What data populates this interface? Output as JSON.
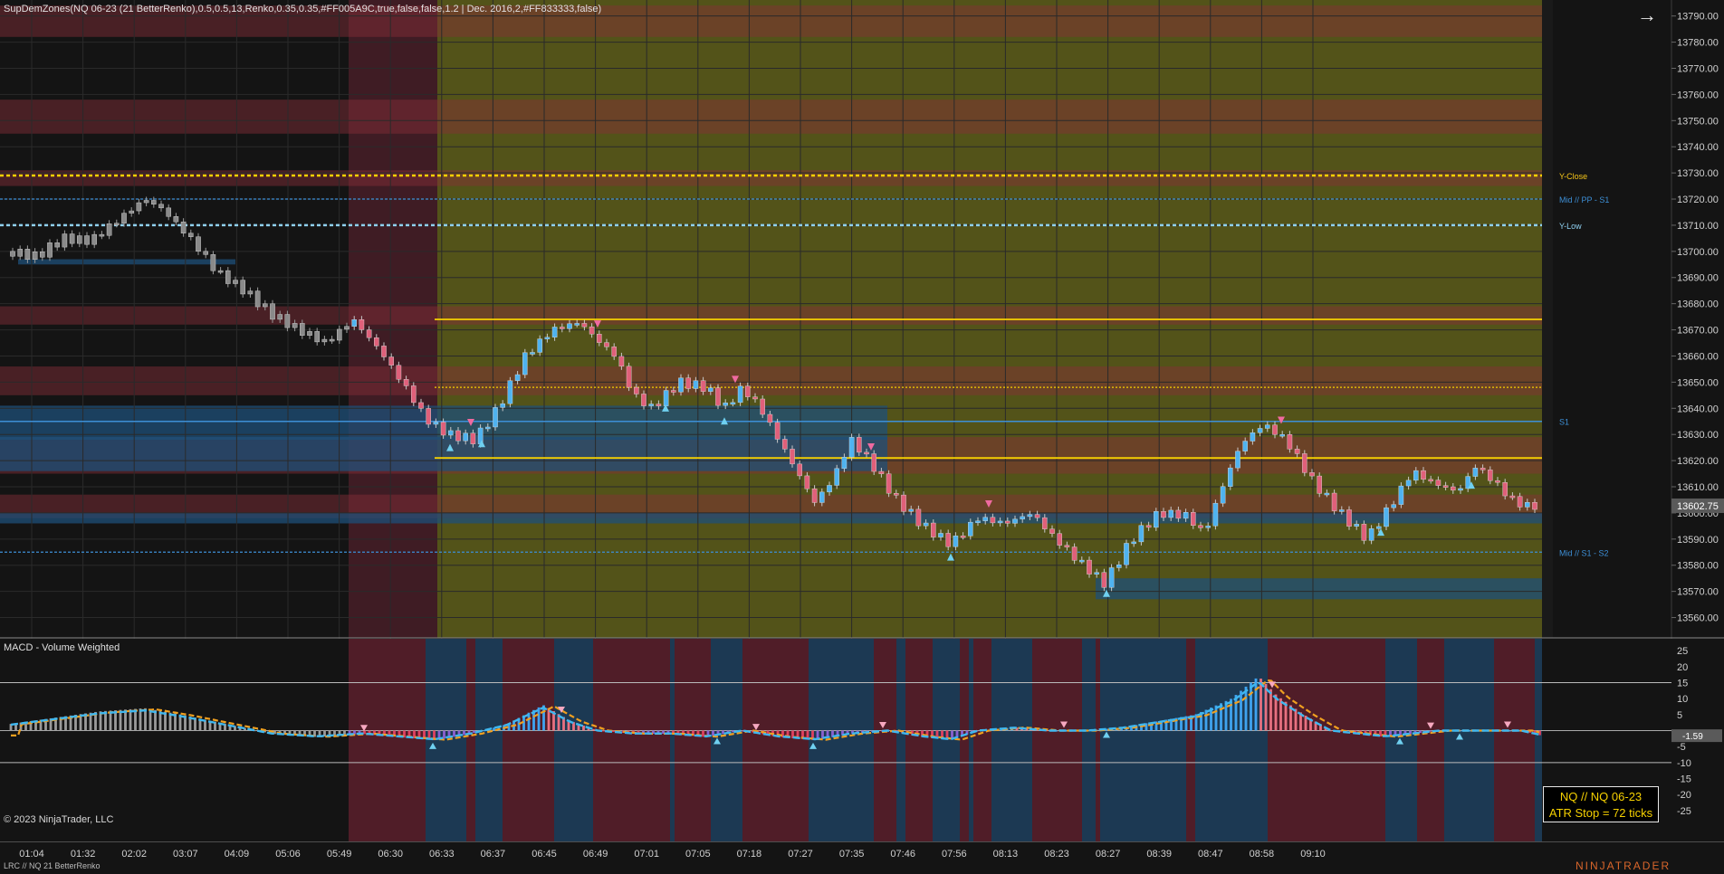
{
  "header": {
    "indicator_title": "SupDemZones(NQ 06-23 (21 BetterRenko),0.5,0.5,13,Renko,0.35,0.35,#FF005A9C,true,false,false,1.2 | Dec. 2016,2,#FF833333,false)"
  },
  "price_panel": {
    "y_ticks": [
      "13790.00",
      "13780.00",
      "13770.00",
      "13760.00",
      "13750.00",
      "13740.00",
      "13730.00",
      "13720.00",
      "13710.00",
      "13700.00",
      "13690.00",
      "13680.00",
      "13670.00",
      "13660.00",
      "13650.00",
      "13640.00",
      "13630.00",
      "13620.00",
      "13610.00",
      "13600.00",
      "13590.00",
      "13580.00",
      "13570.00",
      "13560.00"
    ],
    "current_price": "13602.75",
    "line_labels": [
      {
        "text": "Y-Close",
        "price": 13729,
        "color": "#f5c518"
      },
      {
        "text": "Mid // PP - S1",
        "price": 13720,
        "color": "#3d8fd6"
      },
      {
        "text": "Y-Low",
        "price": 13710,
        "color": "#8fd0f0"
      },
      {
        "text": "S1",
        "price": 13635,
        "color": "#3d8fd6"
      },
      {
        "text": "Mid // S1 - S2",
        "price": 13585,
        "color": "#3d8fd6"
      }
    ]
  },
  "macd_panel": {
    "title": "MACD - Volume Weighted",
    "y_ticks": [
      "25",
      "20",
      "15",
      "10",
      "5",
      "-5",
      "-10",
      "-15",
      "-20",
      "-25"
    ],
    "current_value": "-1.59"
  },
  "x_axis": {
    "labels": [
      "01:04",
      "01:32",
      "02:02",
      "03:07",
      "04:09",
      "05:06",
      "05:49",
      "06:30",
      "06:33",
      "06:37",
      "06:45",
      "06:49",
      "07:01",
      "07:05",
      "07:18",
      "07:27",
      "07:35",
      "07:46",
      "07:56",
      "08:13",
      "08:23",
      "08:27",
      "08:39",
      "08:47",
      "08:58",
      "09:10"
    ]
  },
  "info_box": {
    "line1": "NQ // NQ 06-23",
    "line2": "ATR Stop = 72 ticks"
  },
  "footer": {
    "copyright": "© 2023 NinjaTrader, LLC",
    "bottom_label": "LRC // NQ  21 BetterRenko",
    "logo": "NINJATRADER"
  },
  "colors": {
    "background": "#141414",
    "zone_red": "#6b2a2f",
    "zone_olive": "#5a5a1a",
    "zone_blue": "#1d4f78",
    "bar_up": "#4fb3f0",
    "bar_down": "#e0607a",
    "ema_red": "#e0204a",
    "ema_orange": "#f06a10"
  }
}
